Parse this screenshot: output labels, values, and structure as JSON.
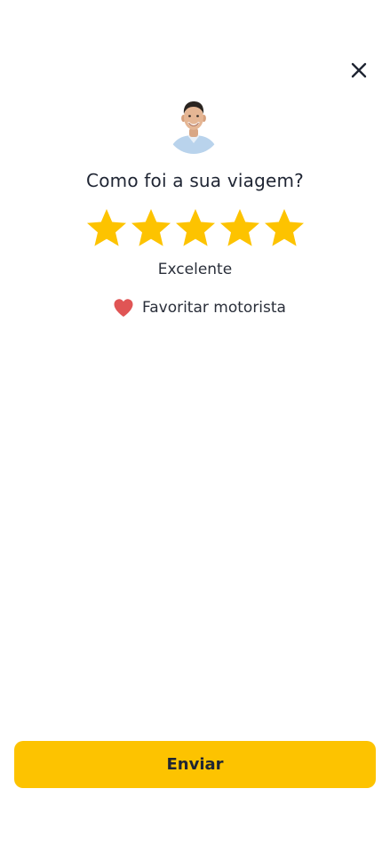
{
  "header": {
    "close_icon": "close-icon"
  },
  "driver": {
    "avatar_icon": "driver-avatar"
  },
  "rating": {
    "question": "Como foi a sua viagem?",
    "stars_selected": 5,
    "stars_total": 5,
    "label": "Excelente",
    "star_color": "#FDC300"
  },
  "favorite": {
    "label": "Favoritar motorista",
    "icon": "heart-icon",
    "color": "#E05555"
  },
  "footer": {
    "submit_label": "Enviar",
    "submit_color": "#FDC300"
  }
}
